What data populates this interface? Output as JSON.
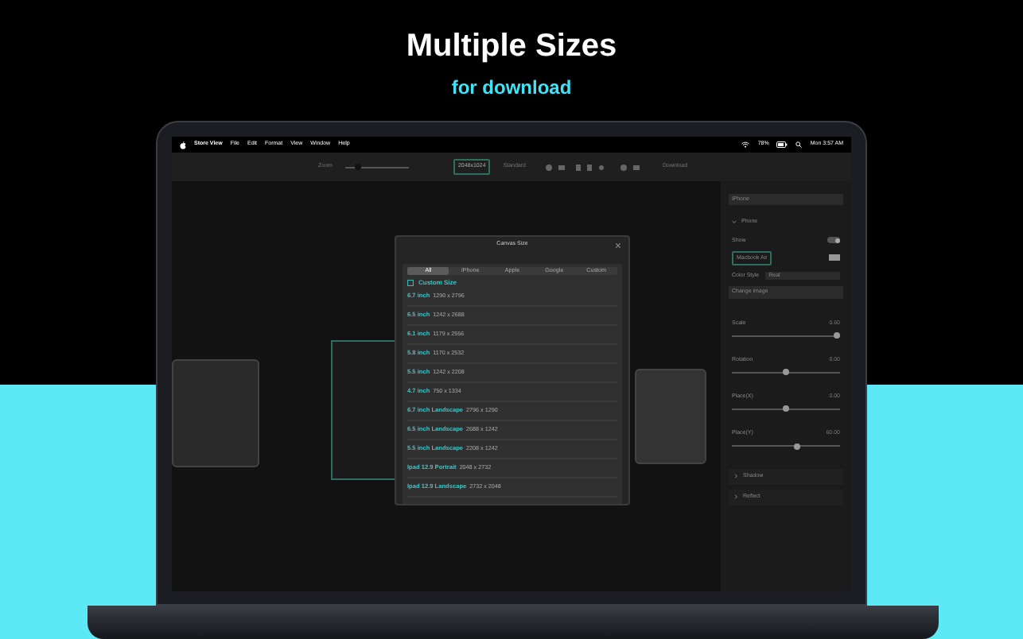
{
  "hero": {
    "title": "Multiple Sizes",
    "subtitle": "for download"
  },
  "menu_bar": {
    "app": "Store View",
    "items": [
      "File",
      "Edit",
      "Format",
      "View",
      "Window",
      "Help"
    ],
    "battery": "78%",
    "clock": "Mon 3:57 AM"
  },
  "toolbar": {
    "zoom_label": "Zoom",
    "zoom": {
      "level": 0.2
    },
    "canvas_size": "2048x1024",
    "style": "Standard",
    "download": "Download"
  },
  "dialog": {
    "title": "Canvas Size",
    "tabs": [
      {
        "label": "All",
        "selected": true
      },
      {
        "label": "iPhone",
        "selected": false
      },
      {
        "label": "Apple",
        "selected": false
      },
      {
        "label": "Google",
        "selected": false
      },
      {
        "label": "Custom",
        "selected": false
      }
    ],
    "section": "Custom Size",
    "rows": [
      {
        "name": "6.7 inch",
        "size": "1290 x 2796"
      },
      {
        "name": "6.5 inch",
        "size": "1242 x 2688"
      },
      {
        "name": "6.1 inch",
        "size": "1179 x 2556"
      },
      {
        "name": "5.8 inch",
        "size": "1170 x 2532"
      },
      {
        "name": "5.5 inch",
        "size": "1242 x 2208"
      },
      {
        "name": "4.7 inch",
        "size": "750 x 1334"
      },
      {
        "name": "6.7 inch Landscape",
        "size": "2796 x 1290"
      },
      {
        "name": "6.5 inch Landscape",
        "size": "2688 x 1242"
      },
      {
        "name": "5.5 inch Landscape",
        "size": "2208 x 1242"
      },
      {
        "name": "Ipad 12.9 Portrait",
        "size": "2048 x 2732"
      },
      {
        "name": "Ipad 12.9 Landscape",
        "size": "2732 x 2048"
      }
    ]
  },
  "panel": {
    "device": "iPhone",
    "group": {
      "label": "Phone",
      "expanded": true
    },
    "show": {
      "label": "Show",
      "on": true
    },
    "model": "Macbook Air",
    "color_style": {
      "label": "Color Style",
      "value": "Real"
    },
    "image": "Change image",
    "sliders": [
      {
        "label": "Scale",
        "value": "0.60",
        "level": 0.97
      },
      {
        "label": "Rotation",
        "value": "0.00",
        "level": 0.5
      },
      {
        "label": "Place(X)",
        "value": "0.00",
        "level": 0.5
      },
      {
        "label": "Place(Y)",
        "value": "60.00",
        "level": 0.6
      }
    ],
    "sections": [
      {
        "label": "Shadow",
        "expanded": false
      },
      {
        "label": "Reflect",
        "expanded": false
      }
    ]
  }
}
